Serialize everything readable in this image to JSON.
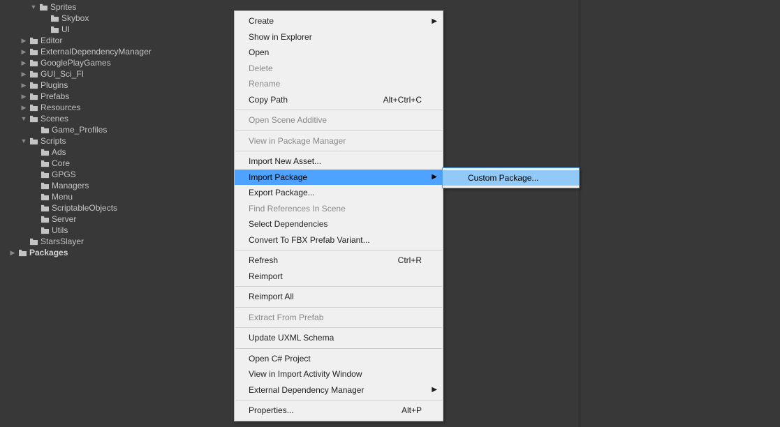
{
  "tree": [
    {
      "indent": 42,
      "arrow": "down",
      "label": "Sprites",
      "bold": false
    },
    {
      "indent": 58,
      "arrow": "none",
      "label": "Skybox",
      "bold": false
    },
    {
      "indent": 58,
      "arrow": "none",
      "label": "UI",
      "bold": false
    },
    {
      "indent": 28,
      "arrow": "right",
      "label": "Editor",
      "bold": false
    },
    {
      "indent": 28,
      "arrow": "right",
      "label": "ExternalDependencyManager",
      "bold": false
    },
    {
      "indent": 28,
      "arrow": "right",
      "label": "GooglePlayGames",
      "bold": false
    },
    {
      "indent": 28,
      "arrow": "right",
      "label": "GUI_Sci_FI",
      "bold": false
    },
    {
      "indent": 28,
      "arrow": "right",
      "label": "Plugins",
      "bold": false
    },
    {
      "indent": 28,
      "arrow": "right",
      "label": "Prefabs",
      "bold": false
    },
    {
      "indent": 28,
      "arrow": "right",
      "label": "Resources",
      "bold": false
    },
    {
      "indent": 28,
      "arrow": "down",
      "label": "Scenes",
      "bold": false
    },
    {
      "indent": 44,
      "arrow": "none",
      "label": "Game_Profiles",
      "bold": false
    },
    {
      "indent": 28,
      "arrow": "down",
      "label": "Scripts",
      "bold": false
    },
    {
      "indent": 44,
      "arrow": "none",
      "label": "Ads",
      "bold": false
    },
    {
      "indent": 44,
      "arrow": "none",
      "label": "Core",
      "bold": false
    },
    {
      "indent": 44,
      "arrow": "none",
      "label": "GPGS",
      "bold": false
    },
    {
      "indent": 44,
      "arrow": "none",
      "label": "Managers",
      "bold": false
    },
    {
      "indent": 44,
      "arrow": "none",
      "label": "Menu",
      "bold": false
    },
    {
      "indent": 44,
      "arrow": "none",
      "label": "ScriptableObjects",
      "bold": false
    },
    {
      "indent": 44,
      "arrow": "none",
      "label": "Server",
      "bold": false
    },
    {
      "indent": 44,
      "arrow": "none",
      "label": "Utils",
      "bold": false
    },
    {
      "indent": 28,
      "arrow": "none",
      "label": "StarsSlayer",
      "bold": false
    },
    {
      "indent": 12,
      "arrow": "right",
      "label": "Packages",
      "bold": true
    }
  ],
  "ctx": {
    "groups": [
      [
        {
          "label": "Create",
          "sub": true
        },
        {
          "label": "Show in Explorer"
        },
        {
          "label": "Open"
        },
        {
          "label": "Delete",
          "disabled": true
        },
        {
          "label": "Rename",
          "disabled": true
        },
        {
          "label": "Copy Path",
          "shortcut": "Alt+Ctrl+C"
        }
      ],
      [
        {
          "label": "Open Scene Additive",
          "disabled": true
        }
      ],
      [
        {
          "label": "View in Package Manager",
          "disabled": true
        }
      ],
      [
        {
          "label": "Import New Asset..."
        },
        {
          "label": "Import Package",
          "sub": true,
          "hl": true
        },
        {
          "label": "Export Package..."
        },
        {
          "label": "Find References In Scene",
          "disabled": true
        },
        {
          "label": "Select Dependencies"
        },
        {
          "label": "Convert To FBX Prefab Variant..."
        }
      ],
      [
        {
          "label": "Refresh",
          "shortcut": "Ctrl+R"
        },
        {
          "label": "Reimport"
        }
      ],
      [
        {
          "label": "Reimport All"
        }
      ],
      [
        {
          "label": "Extract From Prefab",
          "disabled": true
        }
      ],
      [
        {
          "label": "Update UXML Schema"
        }
      ],
      [
        {
          "label": "Open C# Project"
        },
        {
          "label": "View in Import Activity Window"
        },
        {
          "label": "External Dependency Manager",
          "sub": true
        }
      ],
      [
        {
          "label": "Properties...",
          "shortcut": "Alt+P"
        }
      ]
    ]
  },
  "submenu": {
    "items": [
      {
        "label": "Custom Package...",
        "hl": true
      }
    ]
  }
}
